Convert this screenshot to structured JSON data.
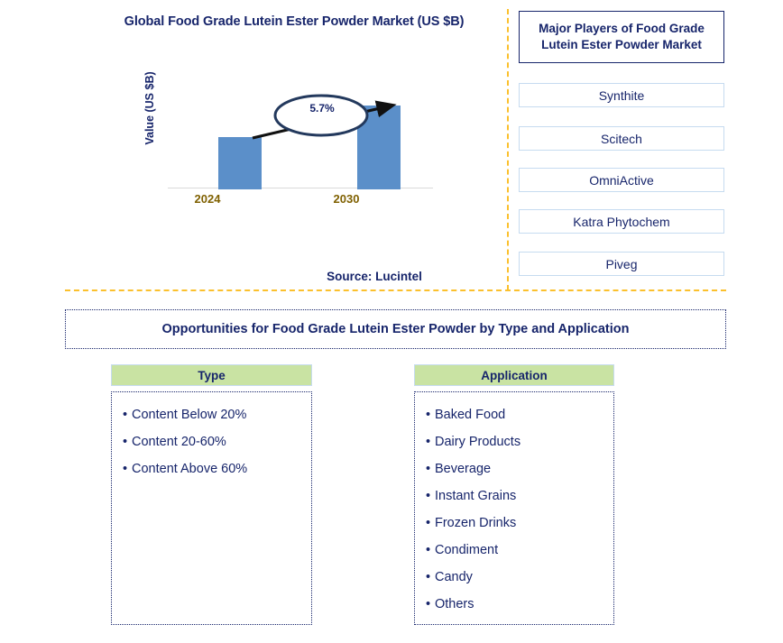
{
  "chart_panel": {
    "title": "Global Food Grade Lutein Ester Powder Market (US $B)",
    "source": "Source: Lucintel"
  },
  "chart_data": {
    "type": "bar",
    "title": "Global Food Grade Lutein Ester Powder Market (US $B)",
    "categories": [
      "2024",
      "2030"
    ],
    "values": [
      1.0,
      1.4
    ],
    "xlabel": "",
    "ylabel": "Value (US $B)",
    "ylim": [
      0,
      1.6
    ],
    "grid": false,
    "legend": "none",
    "annotations": [
      {
        "label": "5.7%",
        "type": "cagr-callout",
        "from": "2024",
        "to": "2030"
      }
    ],
    "tick_labels": [
      "2024",
      "2030"
    ],
    "bar_color": "#5B8FC9",
    "axis_color": "#d9d9d9",
    "tick_label_color": "#7F6000"
  },
  "players_panel": {
    "header_line1": "Major Players of Food Grade",
    "header_line2": "Lutein Ester Powder Market",
    "items": [
      {
        "label": "Synthite"
      },
      {
        "label": "Scitech"
      },
      {
        "label": "OmniActive"
      },
      {
        "label": "Katra Phytochem"
      },
      {
        "label": "Piveg"
      }
    ]
  },
  "opportunities": {
    "banner": "Opportunities for Food Grade Lutein Ester Powder by Type and Application",
    "columns": [
      {
        "header": "Type",
        "items": [
          "Content Below 20%",
          "Content 20-60%",
          "Content Above 60%"
        ]
      },
      {
        "header": "Application",
        "items": [
          "Baked Food",
          "Dairy Products",
          "Beverage",
          "Instant Grains",
          "Frozen Drinks",
          "Condiment",
          "Candy",
          "Others"
        ]
      }
    ]
  },
  "theme": {
    "navy": "#17256b",
    "bar_blue": "#5B8FC9",
    "header_green": "#C9E3A3",
    "divider_gold": "#FBC02D",
    "row_border_blue": "#C6DBF0"
  }
}
